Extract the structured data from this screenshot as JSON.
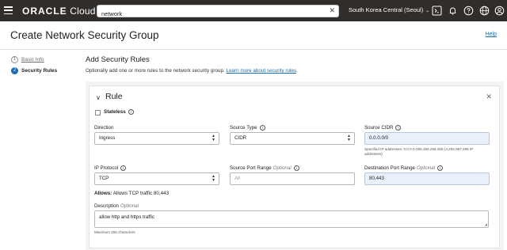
{
  "topbar": {
    "logo_brand": "ORACLE",
    "logo_product": "Cloud",
    "search_value": "network",
    "clear_symbol": "✕",
    "region": "South Korea Central (Seoul)",
    "region_chevron": "⌄",
    "icons": [
      "cloud-shell-icon",
      "bell-icon",
      "help-icon",
      "globe-icon",
      "profile-icon"
    ]
  },
  "header": {
    "title": "Create Network Security Group",
    "help": "Help"
  },
  "steps": [
    {
      "num": "1",
      "label": "Basic Info"
    },
    {
      "num": "2",
      "label": "Security Rules"
    }
  ],
  "main": {
    "title": "Add Security Rules",
    "desc": "Optionally add one or more rules to the network security group. ",
    "desc_link": "Learn more about security rules",
    "desc_end": "."
  },
  "rule": {
    "toggle": "∨",
    "title": "Rule",
    "close": "✕",
    "stateless": "Stateless",
    "info": "i",
    "direction_label": "Direction",
    "direction_value": "Ingress",
    "source_type_label": "Source Type",
    "source_type_value": "CIDR",
    "source_cidr_label": "Source CIDR",
    "source_cidr_value": "0.0.0.0/0",
    "source_cidr_hint_1": "Specified IP addresses: 0.0.0.0-255.255.255.255 (4,294,967,296 IP",
    "source_cidr_hint_2": "addresses)",
    "ip_protocol_label": "IP Protocol",
    "ip_protocol_value": "TCP",
    "source_port_label": "Source Port Range",
    "source_port_optional": "Optional",
    "source_port_placeholder": "All",
    "dest_port_label": "Destination Port Range",
    "dest_port_optional": "Optional",
    "dest_port_value": "80,443",
    "allows_label": "Allows:",
    "allows_text": " Allows TCP traffic 80,443",
    "description_label": "Description",
    "description_optional": "Optional",
    "description_value": "allow http and https traffic",
    "description_hint": "Maximum 255 characters"
  },
  "colors": {
    "topbar": "#312d2a",
    "link": "#1a6bb2",
    "filled_input": "#e9f0fb"
  }
}
